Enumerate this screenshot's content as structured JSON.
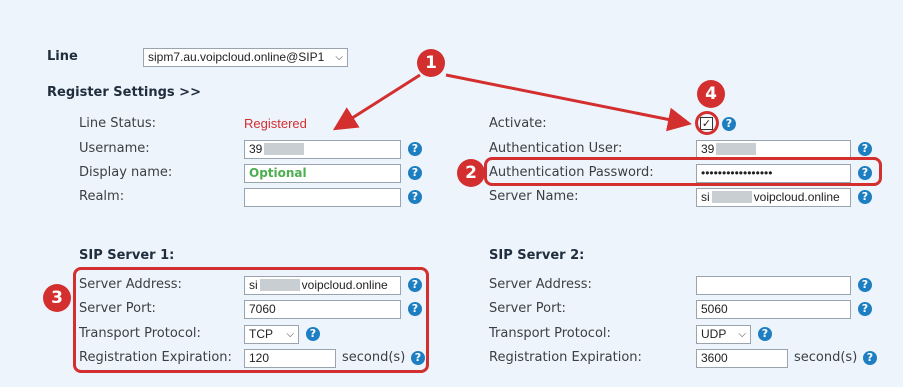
{
  "line": {
    "label": "Line",
    "value": "sipm7.au.voipcloud.online@SIP1"
  },
  "register_header": "Register Settings >>",
  "left": {
    "line_status": {
      "label": "Line Status:",
      "value": "Registered"
    },
    "username": {
      "label": "Username:",
      "value_prefix": "39"
    },
    "display_name": {
      "label": "Display name:",
      "value": "Optional"
    },
    "realm": {
      "label": "Realm:",
      "value": ""
    }
  },
  "right": {
    "activate": {
      "label": "Activate:",
      "checked": true
    },
    "auth_user": {
      "label": "Authentication User:",
      "value_prefix": "39"
    },
    "auth_password": {
      "label": "Authentication Password:",
      "value": "•••••••••••••••••"
    },
    "server_name": {
      "label": "Server Name:",
      "value_prefix": "si",
      "value_suffix": "voipcloud.online"
    }
  },
  "sip1": {
    "title": "SIP Server 1:",
    "address": {
      "label": "Server Address:",
      "value_prefix": "si",
      "value_suffix": "voipcloud.online"
    },
    "port": {
      "label": "Server Port:",
      "value": "7060"
    },
    "transport": {
      "label": "Transport Protocol:",
      "value": "TCP"
    },
    "expiration": {
      "label": "Registration Expiration:",
      "value": "120",
      "unit": "second(s)"
    }
  },
  "sip2": {
    "title": "SIP Server 2:",
    "address": {
      "label": "Server Address:",
      "value": ""
    },
    "port": {
      "label": "Server Port:",
      "value": "5060"
    },
    "transport": {
      "label": "Transport Protocol:",
      "value": "UDP"
    },
    "expiration": {
      "label": "Registration Expiration:",
      "value": "3600",
      "unit": "second(s)"
    }
  },
  "help_glyph": "?",
  "caret_glyph": "⌵",
  "check_glyph": "✓",
  "annotations": {
    "badge1": "1",
    "badge2": "2",
    "badge3": "3",
    "badge4": "4",
    "color": "#d32f2f"
  }
}
